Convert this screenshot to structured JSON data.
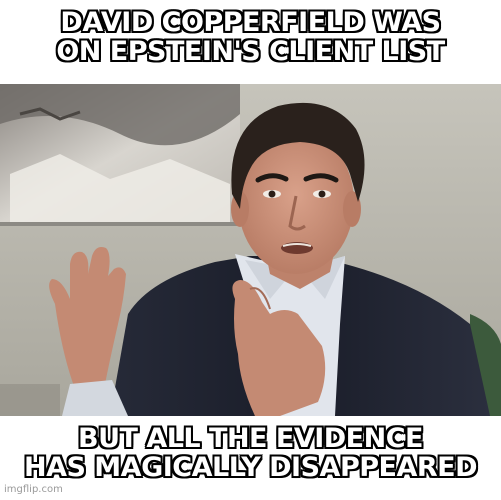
{
  "caption_top": {
    "line1": "DAVID COPPERFIELD WAS",
    "line2": "ON EPSTEIN'S CLIENT LIST"
  },
  "caption_bottom": {
    "line1": "BUT ALL THE EVIDENCE",
    "line2": "HAS MAGICALLY DISAPPEARED"
  },
  "watermark": "imgflip.com",
  "colors": {
    "caption_fill": "#ffffff",
    "caption_outline": "#000000",
    "background": "#ffffff",
    "wall": "#b9b7ae",
    "jacket": "#1f2230",
    "shirt": "#dfe3ea",
    "skin": "#c98f78",
    "hair": "#2a211c"
  }
}
